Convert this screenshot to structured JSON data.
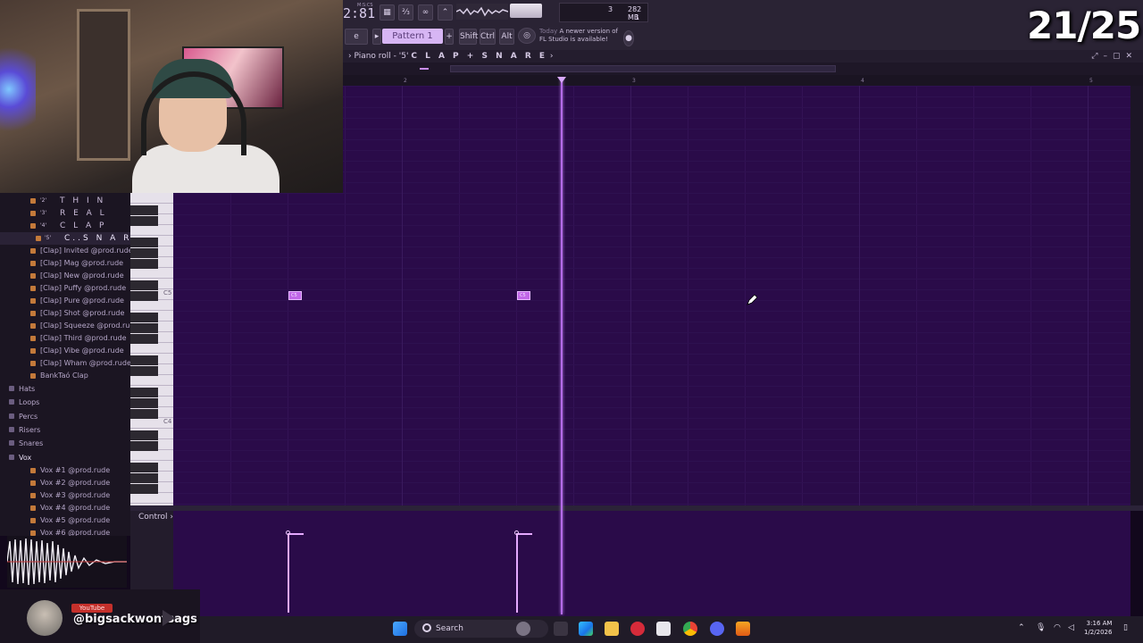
{
  "counter": "21/25",
  "toolbar": {
    "time": "2:81",
    "time_label": "M:S:CS",
    "pattern": "Pattern 1",
    "keys": [
      "Shift",
      "Ctrl",
      "Alt"
    ],
    "memory": "282 MB",
    "cpu_num": "3",
    "cpu_sub": "1",
    "notice_day": "Today",
    "notice_line1": "A newer version of",
    "notice_line2": "FL Studio is available!"
  },
  "piano_roll": {
    "title_prefix": "Piano roll - ",
    "pattern_num": "'5'",
    "pattern_name": "C L A P + S N A R E",
    "ruler": [
      "2",
      "3",
      "4",
      "5"
    ],
    "key_labels": [
      "C5",
      "C4"
    ],
    "notes": [
      {
        "label": "C5",
        "bar": 1.5
      },
      {
        "label": "C5",
        "bar": 2.5
      }
    ]
  },
  "browser": {
    "patterns": [
      {
        "num": "'2'",
        "name": "T H I N"
      },
      {
        "num": "'3'",
        "name": "R E A L"
      },
      {
        "num": "'4'",
        "name": "C L A P"
      },
      {
        "num": "'5'",
        "name": "C..S N A R E"
      }
    ],
    "clap_files": [
      "[Clap] Invited @prod.rude",
      "[Clap] Mag @prod.rude",
      "[Clap] New @prod.rude",
      "[Clap] Puffy @prod.rude",
      "[Clap] Pure @prod.rude",
      "[Clap] Shot @prod.rude",
      "[Clap] Squeeze @prod.rude",
      "[Clap] Third @prod.rude",
      "[Clap] Vibe @prod.rude",
      "[Clap] Wham @prod.rude",
      "BankTaó Clap"
    ],
    "folders": [
      "Hats",
      "Loops",
      "Percs",
      "Risers",
      "Snares",
      "Vox"
    ],
    "vox_files": [
      "Vox #1 @prod.rude",
      "Vox #2 @prod.rude",
      "Vox #3 @prod.rude",
      "Vox #4 @prod.rude",
      "Vox #5 @prod.rude",
      "Vox #6 @prod.rude"
    ]
  },
  "control": {
    "label": "Control",
    "arrow": "›"
  },
  "overlay": {
    "badge": "YouTube",
    "username": "@bigsackwontsags"
  },
  "taskbar": {
    "search": "Search",
    "time": "3:16 AM",
    "date": "1/2/2026"
  },
  "colors": {
    "grid": "#2a0b49",
    "note": "#c167e8",
    "playhead": "#b46be8",
    "pattern_highlight": "#d7b6f4"
  }
}
